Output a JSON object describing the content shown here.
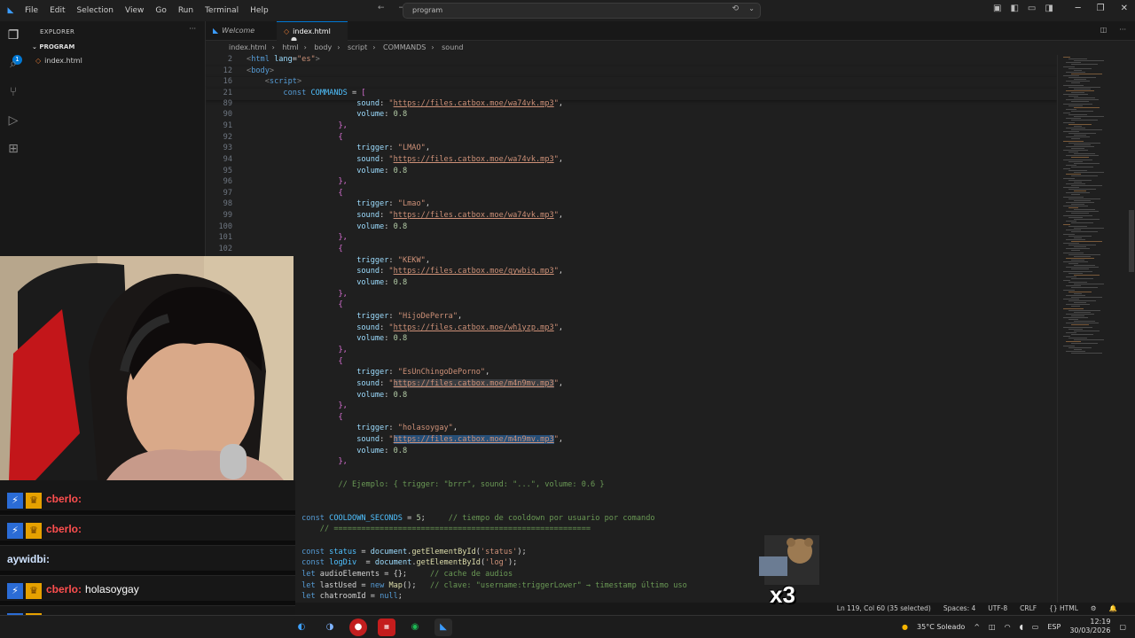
{
  "titlebar": {
    "menu": [
      "File",
      "Edit",
      "Selection",
      "View",
      "Go",
      "Run",
      "Terminal",
      "Help"
    ],
    "search": "program"
  },
  "explorer": {
    "title": "EXPLORER",
    "folder": "PROGRAM",
    "file": "index.html"
  },
  "tabs": [
    {
      "label": "Welcome",
      "active": false
    },
    {
      "label": "index.html",
      "active": true,
      "modified": true
    }
  ],
  "breadcrumb": [
    "index.html",
    "html",
    "body",
    "script",
    "COMMANDS",
    "sound"
  ],
  "sticky": [
    {
      "ln": "2",
      "code": "<html lang=\"es\">"
    },
    {
      "ln": "12",
      "code": "<body>"
    },
    {
      "ln": "16",
      "code": "<script>"
    },
    {
      "ln": "21",
      "code": "const COMMANDS = ["
    }
  ],
  "code_lines": [
    {
      "ln": "89",
      "indent": 6,
      "key": "sound",
      "val": "https://files.catbox.moe/wa74vk.mp3"
    },
    {
      "ln": "90",
      "indent": 6,
      "key": "volume",
      "num": "0.8"
    },
    {
      "ln": "91",
      "indent": 5,
      "raw": "},"
    },
    {
      "ln": "92",
      "indent": 5,
      "raw": "{"
    },
    {
      "ln": "93",
      "indent": 6,
      "key": "trigger",
      "str": "LMAO"
    },
    {
      "ln": "94",
      "indent": 6,
      "key": "sound",
      "val": "https://files.catbox.moe/wa74vk.mp3"
    },
    {
      "ln": "95",
      "indent": 6,
      "key": "volume",
      "num": "0.8"
    },
    {
      "ln": "96",
      "indent": 5,
      "raw": "},"
    },
    {
      "ln": "97",
      "indent": 5,
      "raw": "{"
    },
    {
      "ln": "98",
      "indent": 6,
      "key": "trigger",
      "str": "Lmao"
    },
    {
      "ln": "99",
      "indent": 6,
      "key": "sound",
      "val": "https://files.catbox.moe/wa74vk.mp3"
    },
    {
      "ln": "100",
      "indent": 6,
      "key": "volume",
      "num": "0.8"
    },
    {
      "ln": "101",
      "indent": 5,
      "raw": "},"
    },
    {
      "ln": "102",
      "indent": 5,
      "raw": "{"
    },
    {
      "ln": "",
      "indent": 6,
      "key": "trigger",
      "str": "KEKW"
    },
    {
      "ln": "",
      "indent": 6,
      "key": "sound",
      "val": "https://files.catbox.moe/gywbig.mp3"
    },
    {
      "ln": "",
      "indent": 6,
      "key": "volume",
      "num": "0.8"
    },
    {
      "ln": "",
      "indent": 5,
      "raw": "},"
    },
    {
      "ln": "",
      "indent": 5,
      "raw": "{"
    },
    {
      "ln": "",
      "indent": 6,
      "key": "trigger",
      "str": "HijoDePerra"
    },
    {
      "ln": "",
      "indent": 6,
      "key": "sound",
      "val": "https://files.catbox.moe/wh1yzp.mp3"
    },
    {
      "ln": "",
      "indent": 6,
      "key": "volume",
      "num": "0.8"
    },
    {
      "ln": "",
      "indent": 5,
      "raw": "},"
    },
    {
      "ln": "",
      "indent": 5,
      "raw": "{"
    },
    {
      "ln": "",
      "indent": 6,
      "key": "trigger",
      "str": "EsUnChingoDePorno"
    },
    {
      "ln": "",
      "indent": 6,
      "key": "sound",
      "val": "https://files.catbox.moe/m4n9mv.mp3",
      "hl": true
    },
    {
      "ln": "",
      "indent": 6,
      "key": "volume",
      "num": "0.8"
    },
    {
      "ln": "",
      "indent": 5,
      "raw": "},"
    },
    {
      "ln": "",
      "indent": 5,
      "raw": "{"
    },
    {
      "ln": "",
      "indent": 6,
      "key": "trigger",
      "str": "holasoygay"
    },
    {
      "ln": "",
      "indent": 6,
      "key": "sound",
      "val": "https://files.catbox.moe/m4n9mv.mp3",
      "sel": true
    },
    {
      "ln": "",
      "indent": 6,
      "key": "volume",
      "num": "0.8"
    },
    {
      "ln": "",
      "indent": 5,
      "raw": "},"
    },
    {
      "ln": "",
      "indent": 0,
      "raw": ""
    },
    {
      "ln": "",
      "indent": 5,
      "cmt": "// Ejemplo: { trigger: \"brrr\", sound: \"...\", volume: 0.6 }"
    },
    {
      "ln": "",
      "indent": 0,
      "raw": ""
    },
    {
      "ln": "",
      "indent": 0,
      "raw": ""
    },
    {
      "ln": "",
      "indent": 4,
      "cooldown": true
    },
    {
      "ln": "",
      "indent": 4,
      "cmt": "// ========================================================"
    },
    {
      "ln": "",
      "indent": 0,
      "raw": ""
    },
    {
      "ln": "",
      "indent": 4,
      "decl": "const status = document.getElementById('status');"
    },
    {
      "ln": "",
      "indent": 4,
      "decl": "const logDiv  = document.getElementById('log');"
    },
    {
      "ln": "",
      "indent": 4,
      "decl2": "let audioElements = {};",
      "c2": "// cache de audios"
    },
    {
      "ln": "",
      "indent": 4,
      "decl2": "let lastUsed = new Map();",
      "c2": "// clave: \"username:triggerLower\" → timestamp último uso"
    },
    {
      "ln": "",
      "indent": 4,
      "decl2": "let chatroomId = null;",
      "c2": ""
    }
  ],
  "status": {
    "position": "Ln 119, Col 60 (35 selected)",
    "spaces": "Spaces: 4",
    "encoding": "UTF-8",
    "eol": "CRLF",
    "language": "HTML"
  },
  "chat": [
    {
      "name": "cberlo:",
      "msg": ""
    },
    {
      "name": "cberlo:",
      "msg": ""
    },
    {
      "name": "aywidbi:",
      "msg": "",
      "plain": true
    },
    {
      "name": "cberlo:",
      "msg": "holasoygay"
    },
    {
      "name": "cberlo:",
      "msg": "holasoygay"
    }
  ],
  "sticker": {
    "text": "x3"
  },
  "taskbar": {
    "weather": "35°C  Soleado",
    "lang": "ESP",
    "time": "12:19",
    "date": "30/03/2026"
  },
  "colors": {
    "accent": "#0078d4",
    "chat_name": "#ff4f4f"
  }
}
